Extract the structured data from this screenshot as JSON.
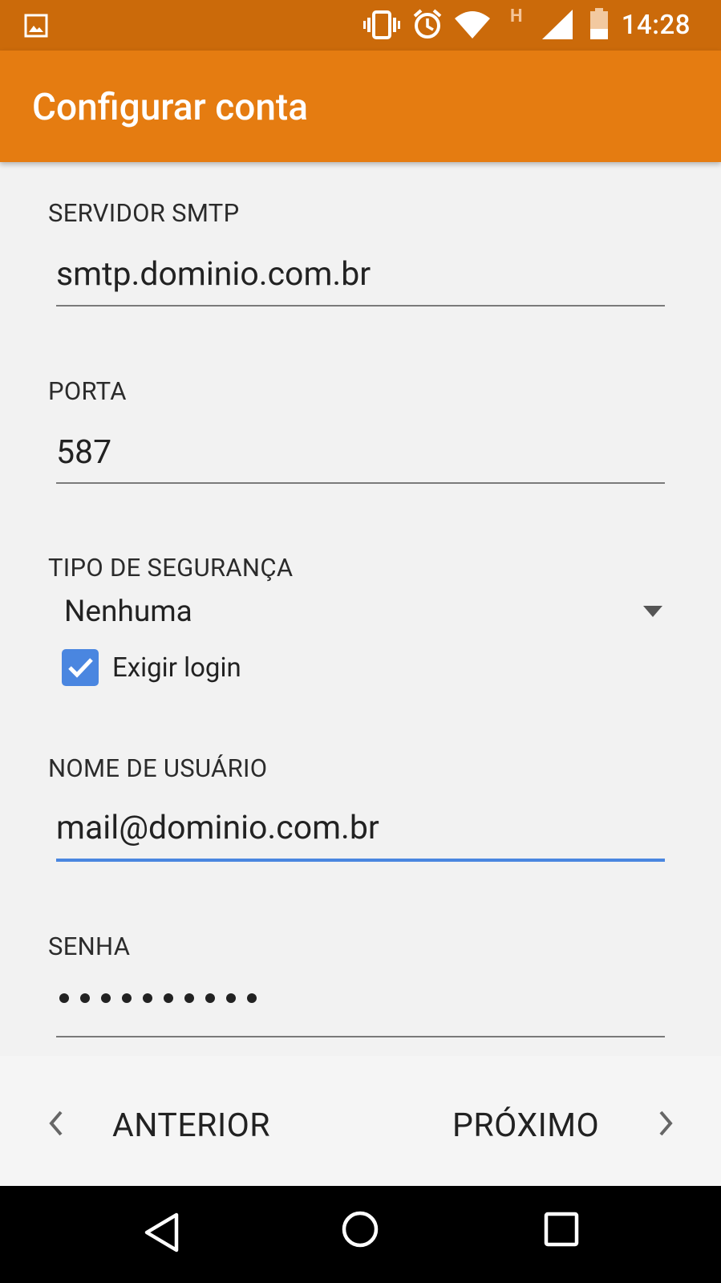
{
  "status_bar": {
    "time": "14:28",
    "network_type": "H",
    "icons": [
      "image-icon",
      "vibrate-icon",
      "alarm-icon",
      "wifi-icon",
      "signal-icon",
      "battery-icon"
    ],
    "colors": {
      "background": "#cb6a0a"
    }
  },
  "app_bar": {
    "title": "Configurar conta",
    "colors": {
      "background": "#e57c11",
      "text": "#ffffff"
    }
  },
  "form": {
    "smtp_server": {
      "label": "SERVIDOR SMTP",
      "value": "smtp.dominio.com.br"
    },
    "port": {
      "label": "PORTA",
      "value": "587"
    },
    "security_type": {
      "label": "TIPO DE SEGURANÇA",
      "selected": "Nenhuma"
    },
    "require_login": {
      "label": "Exigir login",
      "checked": true
    },
    "username": {
      "label": "NOME DE USUÁRIO",
      "value": "mail@dominio.com.br",
      "focused": true
    },
    "password": {
      "label": "SENHA",
      "masked_length": 10
    }
  },
  "wizard": {
    "previous_label": "ANTERIOR",
    "next_label": "PRÓXIMO"
  },
  "colors": {
    "accent": "#4a86e0",
    "focus_underline": "#4a86e0"
  },
  "nav_bar": {
    "icons": [
      "back-icon",
      "home-icon",
      "recents-icon"
    ]
  }
}
